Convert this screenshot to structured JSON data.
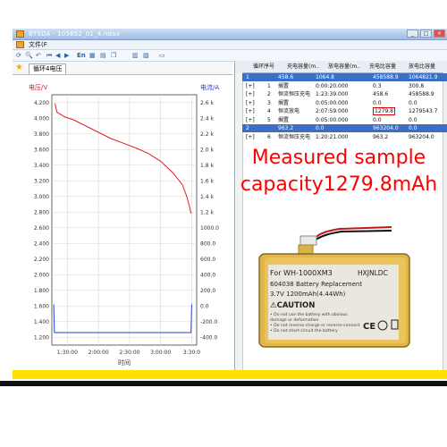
{
  "app": {
    "title": "BTSDA - 105852_01_4.ndax",
    "menu_file": "文件(F",
    "window_buttons": [
      "_",
      "□",
      "×"
    ]
  },
  "toolbar": {
    "items": [
      "En"
    ]
  },
  "tab": {
    "label": "循环4电压"
  },
  "chart_data": {
    "type": "line",
    "title": "",
    "xlabel": "时间",
    "ylabel_left": "电压/V",
    "ylabel_right": "电流/A",
    "x_ticks": [
      "1:30:00",
      "2:00:00",
      "2:30:00",
      "3:00:00",
      "3:30:0"
    ],
    "y_left_ticks": [
      4.2,
      4.0,
      3.8,
      3.6,
      3.4,
      3.2,
      3.0,
      2.8,
      2.6,
      2.4,
      2.2,
      2.0,
      1.8,
      1.6,
      1.4,
      1.2
    ],
    "y_right_ticks": [
      "2.6 k",
      "2.4 k",
      "2.2 k",
      "2.0 k",
      "1.8 k",
      "1.6 k",
      "1.4 k",
      "1.2 k",
      "1000.0",
      "800.0",
      "600.0",
      "400.0",
      "200.0",
      "0.0",
      "-200.0",
      "-400.0"
    ],
    "y_left_range": [
      1.1,
      4.3
    ],
    "x_range_hours": [
      1.25,
      3.58
    ],
    "voltage_series": {
      "name": "voltage",
      "color": "#e02020",
      "points": [
        [
          1.3,
          4.19
        ],
        [
          1.33,
          4.08
        ],
        [
          1.45,
          4.02
        ],
        [
          1.6,
          3.98
        ],
        [
          1.8,
          3.9
        ],
        [
          2.0,
          3.82
        ],
        [
          2.2,
          3.74
        ],
        [
          2.4,
          3.68
        ],
        [
          2.6,
          3.62
        ],
        [
          2.8,
          3.55
        ],
        [
          3.0,
          3.45
        ],
        [
          3.2,
          3.3
        ],
        [
          3.35,
          3.15
        ],
        [
          3.42,
          3.0
        ],
        [
          3.47,
          2.85
        ],
        [
          3.49,
          2.78
        ]
      ]
    },
    "current_series": {
      "name": "current",
      "color": "#2040e0",
      "points": [
        [
          1.28,
          1.62
        ],
        [
          1.29,
          1.26
        ],
        [
          3.49,
          1.26
        ],
        [
          3.5,
          1.62
        ]
      ]
    }
  },
  "table": {
    "headers": [
      "循环序号",
      "充电容量(m..",
      "放电容量(m..",
      "充电比容量",
      "放电比容量"
    ],
    "rows": [
      {
        "c1": "1",
        "c2": "",
        "c3": "458.6",
        "c4": "1064.8",
        "c5": "458588.9",
        "c6": "1064821.9",
        "selected": true
      },
      {
        "c1": "[+]",
        "c2": "1",
        "c3": "搁置",
        "c4": "0:00:20.000",
        "c5": "0.3",
        "c6": "300.8",
        "selected": false
      },
      {
        "c1": "[+]",
        "c2": "2",
        "c3": "恒流恒压充电",
        "c4": "1:23:39.000",
        "c5": "458.6",
        "c6": "458588.9",
        "selected": false
      },
      {
        "c1": "[+]",
        "c2": "3",
        "c3": "搁置",
        "c4": "0:05:00.000",
        "c5": "0.0",
        "c6": "0.0",
        "selected": false
      },
      {
        "c1": "[+]",
        "c2": "4",
        "c3": "恒流放电",
        "c4": "2:07:59.000",
        "c5": "1279.8",
        "c6": "1279543.7",
        "selected": false
      },
      {
        "c1": "[+]",
        "c2": "5",
        "c3": "搁置",
        "c4": "0:05:00.000",
        "c5": "0.0",
        "c6": "0.0",
        "selected": false
      },
      {
        "c1": "2",
        "c2": "",
        "c3": "963.2",
        "c4": "0.0",
        "c5": "963204.0",
        "c6": "0.0",
        "selected": true
      },
      {
        "c1": "[+]",
        "c2": "6",
        "c3": "恒流恒压充电",
        "c4": "1:20:21.000",
        "c5": "963.2",
        "c6": "963204.0",
        "selected": false
      }
    ]
  },
  "annotation": {
    "line1": "Measured sample",
    "line2": "capacity1279.8mAh",
    "color": "#ff0000"
  },
  "battery": {
    "model": "For WH-1000XM3",
    "brand": "HXJNLDC",
    "part": "604038  Battery Replacement",
    "spec": "3.7V 1200mAh(4.44Wh)",
    "caution": "⚠CAUTION",
    "warn1": "• Do not use the battery with obvious",
    "warn2": "  damage or deformation",
    "warn3": "• Do not reverse-charge or reverse-connect",
    "warn4": "• Do not short-circuit the battery",
    "ce_mark": "CE"
  }
}
